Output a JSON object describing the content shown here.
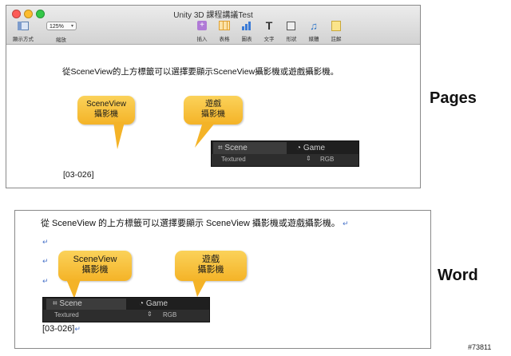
{
  "pages": {
    "window_title": "Unity 3D 課程講議Test",
    "toolbar": {
      "view_label": "顯示方式",
      "zoom_value": "125%",
      "zoom_label": "縮放",
      "insert_label": "插入",
      "table_label": "表格",
      "chart_label": "圖表",
      "text_label": "文字",
      "shape_label": "形狀",
      "media_label": "媒體",
      "comment_label": "註解"
    },
    "body_text": "從SceneView的上方標籤可以選擇要顯示SceneView攝影機或遊戲攝影機。",
    "callout_scene": [
      "SceneView",
      "攝影機"
    ],
    "callout_game": [
      "遊戲",
      "攝影機"
    ],
    "unity_tabs": {
      "scene": "Scene",
      "game": "Game"
    },
    "unity_sub": {
      "textured": "Textured",
      "rgb": "RGB"
    },
    "figure_ref": "[03-026]"
  },
  "word": {
    "body_text": "從 SceneView 的上方標籤可以選擇要顯示 SceneView 攝影機或遊戲攝影機。",
    "para_mark": "↵",
    "callout_scene": [
      "SceneView",
      "攝影機"
    ],
    "callout_game": [
      "遊戲",
      "攝影機"
    ],
    "unity_tabs": {
      "scene": "Scene",
      "game": "Game"
    },
    "unity_sub": {
      "textured": "Textured",
      "rgb": "RGB"
    },
    "figure_ref": "[03-026]"
  },
  "labels": {
    "pages": "Pages",
    "word": "Word"
  },
  "watermark": "#73811",
  "colors": {
    "callout": "#f4b327",
    "unity_bg": "#2d2d2d",
    "para_mark": "#4a74c9"
  }
}
